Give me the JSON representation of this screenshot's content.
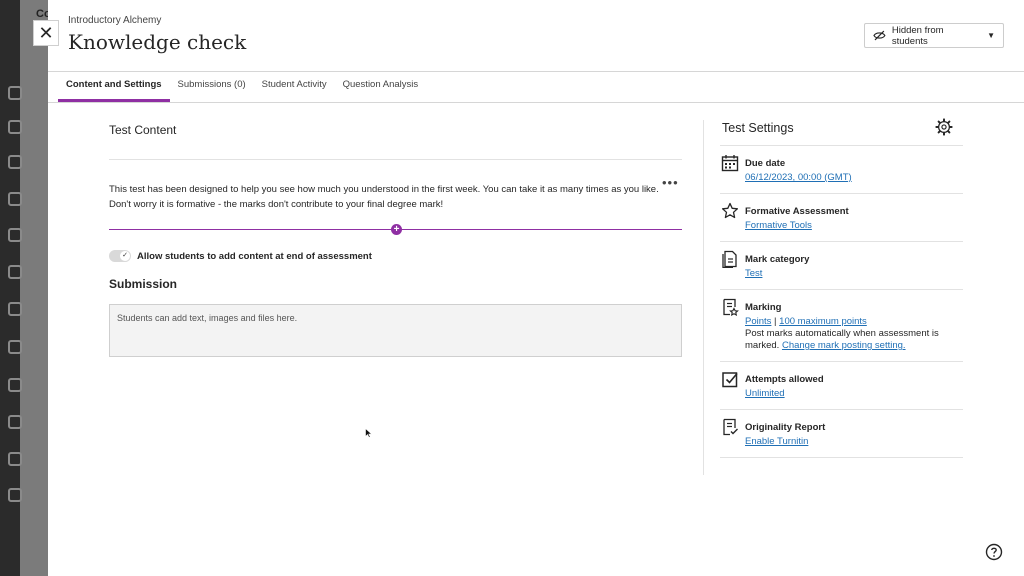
{
  "background": {
    "partial_text": "Co"
  },
  "header": {
    "course": "Introductory Alchemy",
    "title": "Knowledge check",
    "visibility": "Hidden from students"
  },
  "tabs": [
    {
      "label": "Content and Settings",
      "active": true
    },
    {
      "label": "Submissions (0)",
      "active": false
    },
    {
      "label": "Student Activity",
      "active": false
    },
    {
      "label": "Question Analysis",
      "active": false
    }
  ],
  "content": {
    "section_title": "Test Content",
    "description": "This test has been designed to help you see how much you understood in the first week. You can take it as many times as you like. Don't worry it is formative - the marks don't contribute to your final degree mark!",
    "toggle_label": "Allow students to add content at end of assessment",
    "submission_title": "Submission",
    "submission_placeholder": "Students can add text, images and files here."
  },
  "settings": {
    "title": "Test Settings",
    "due_date": {
      "name": "Due date",
      "value": "06/12/2023, 00:00 (GMT)"
    },
    "formative": {
      "name": "Formative Assessment",
      "value": "Formative Tools"
    },
    "mark_category": {
      "name": "Mark category",
      "value": "Test"
    },
    "marking": {
      "name": "Marking",
      "points": "Points",
      "separator": "|",
      "max_points": "100 maximum points",
      "post_text": "Post marks automatically when assessment is marked.",
      "change_link": "Change mark posting setting."
    },
    "attempts": {
      "name": "Attempts allowed",
      "value": "Unlimited"
    },
    "originality": {
      "name": "Originality Report",
      "value": "Enable Turnitin"
    }
  },
  "colors": {
    "accent": "#8f2fa3",
    "link": "#1f6fb5"
  }
}
